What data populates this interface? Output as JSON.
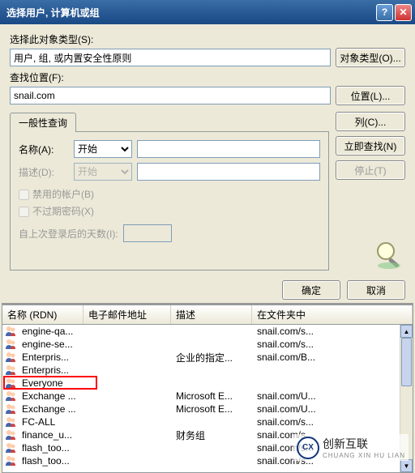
{
  "title": "选择用户, 计算机或组",
  "labels": {
    "object_type": "选择此对象类型(S):",
    "object_type_value": "用户, 组, 或内置安全性原则",
    "object_type_btn": "对象类型(O)...",
    "location": "查找位置(F):",
    "location_value": "snail.com",
    "location_btn": "位置(L)...",
    "tab_general": "一般性查询",
    "name": "名称(A):",
    "name_op": "开始",
    "desc": "描述(D):",
    "desc_op": "开始",
    "chk_disabled": "禁用的帐户(B)",
    "chk_nopwd": "不过期密码(X)",
    "days_label": "自上次登录后的天数(I):",
    "col_btn": "列(C)...",
    "findnow_btn": "立即查找(N)",
    "stop_btn": "停止(T)",
    "ok_btn": "确定",
    "cancel_btn": "取消"
  },
  "columns": {
    "name": "名称 (RDN)",
    "email": "电子邮件地址",
    "desc": "描述",
    "folder": "在文件夹中"
  },
  "rows": [
    {
      "name": "engine-qa...",
      "email": "",
      "desc": "",
      "folder": "snail.com/s..."
    },
    {
      "name": "engine-se...",
      "email": "",
      "desc": "",
      "folder": "snail.com/s..."
    },
    {
      "name": "Enterpris...",
      "email": "",
      "desc": "企业的指定...",
      "folder": "snail.com/B..."
    },
    {
      "name": "Enterpris...",
      "email": "",
      "desc": "",
      "folder": ""
    },
    {
      "name": "Everyone",
      "email": "",
      "desc": "",
      "folder": "",
      "highlight": true
    },
    {
      "name": "Exchange ...",
      "email": "",
      "desc": "Microsoft E...",
      "folder": "snail.com/U..."
    },
    {
      "name": "Exchange ...",
      "email": "",
      "desc": "Microsoft E...",
      "folder": "snail.com/U..."
    },
    {
      "name": "FC-ALL",
      "email": "",
      "desc": "",
      "folder": "snail.com/s..."
    },
    {
      "name": "finance_u...",
      "email": "",
      "desc": "财务组",
      "folder": "snail.com/s..."
    },
    {
      "name": "flash_too...",
      "email": "",
      "desc": "",
      "folder": "snail.com/s..."
    },
    {
      "name": "flash_too...",
      "email": "",
      "desc": "",
      "folder": "snail.com/s..."
    }
  ],
  "watermark": {
    "text": "创新互联",
    "sub": "CHUANG XIN HU LIAN"
  }
}
